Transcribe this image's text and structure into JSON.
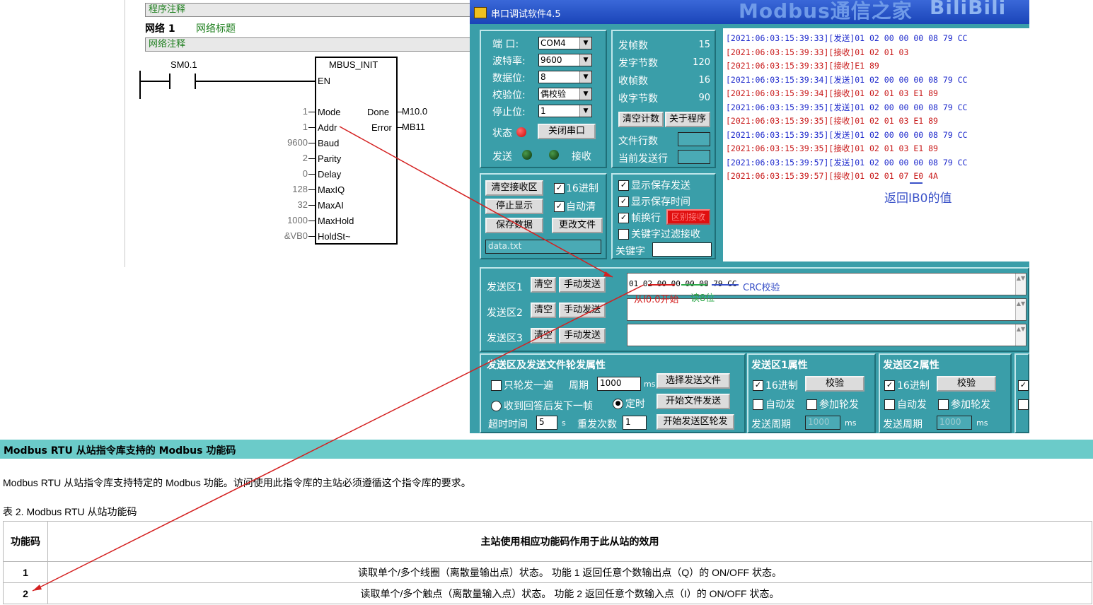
{
  "plc": {
    "program_comment": "程序注释",
    "network_label": "网络 1",
    "network_title": "网络标题",
    "network_comment": "网络注释",
    "contact": "SM0.1",
    "block_name": "MBUS_INIT",
    "en": "EN",
    "inputs": [
      {
        "value": "1",
        "pin": "Mode"
      },
      {
        "value": "1",
        "pin": "Addr"
      },
      {
        "value": "9600",
        "pin": "Baud"
      },
      {
        "value": "2",
        "pin": "Parity"
      },
      {
        "value": "0",
        "pin": "Delay"
      },
      {
        "value": "128",
        "pin": "MaxIQ"
      },
      {
        "value": "32",
        "pin": "MaxAI"
      },
      {
        "value": "1000",
        "pin": "MaxHold"
      },
      {
        "value": "&VB0",
        "pin": "HoldSt~"
      }
    ],
    "outputs": [
      {
        "pin": "Done",
        "value": "M10.0"
      },
      {
        "pin": "Error",
        "value": "MB11"
      }
    ]
  },
  "serial": {
    "title": "串口调试软件4.5",
    "watermark": "Modbus通信之家",
    "watermark2": "BiliBili",
    "port_label": "端  口:",
    "port": "COM4",
    "baud_label": "波特率:",
    "baud": "9600",
    "databits_label": "数据位:",
    "databits": "8",
    "parity_label": "校验位:",
    "parity": "偶校验",
    "stopbits_label": "停止位:",
    "stopbits": "1",
    "status_label": "状态",
    "close_port": "关闭串口",
    "send_label": "发送",
    "recv_label": "接收",
    "counters": [
      {
        "label": "发帧数",
        "value": "15"
      },
      {
        "label": "发字节数",
        "value": "120"
      },
      {
        "label": "收帧数",
        "value": "16"
      },
      {
        "label": "收字节数",
        "value": "90"
      }
    ],
    "clear_count": "清空计数",
    "about": "关于程序",
    "file_lines": "文件行数",
    "cur_line": "当前发送行",
    "clear_recv": "清空接收区",
    "hex16_recv": "16进制",
    "stop_display": "停止显示",
    "auto_clear": "自动清",
    "save_data": "保存数据",
    "change_file": "更改文件",
    "filename": "data.txt",
    "show_save_send": "显示保存发送",
    "show_save_time": "显示保存时间",
    "frame_newline": "帧换行",
    "distinguish": "区别接收",
    "keyword_filter": "关键字过滤接收",
    "keyword": "关键字",
    "recv_lines": [
      {
        "text": "[2021:06:03:15:39:33][发送]01 02 00 00 00 08 79 CC",
        "kind": "tx"
      },
      {
        "text": "[2021:06:03:15:39:33][接收]01 02 01 03",
        "kind": "rx"
      },
      {
        "text": "[2021:06:03:15:39:33][接收]E1 89",
        "kind": "rx"
      },
      {
        "text": "[2021:06:03:15:39:34][发送]01 02 00 00 00 08 79 CC",
        "kind": "tx"
      },
      {
        "text": "[2021:06:03:15:39:34][接收]01 02 01 03 E1 89",
        "kind": "rx"
      },
      {
        "text": "[2021:06:03:15:39:35][发送]01 02 00 00 00 08 79 CC",
        "kind": "tx"
      },
      {
        "text": "[2021:06:03:15:39:35][接收]01 02 01 03 E1 89",
        "kind": "rx"
      },
      {
        "text": "[2021:06:03:15:39:35][发送]01 02 00 00 00 08 79 CC",
        "kind": "tx"
      },
      {
        "text": "[2021:06:03:15:39:35][接收]01 02 01 03 E1 89",
        "kind": "rx"
      },
      {
        "text": "[2021:06:03:15:39:57][发送]01 02 00 00 00 08 79 CC",
        "kind": "tx"
      },
      {
        "text": "[2021:06:03:15:39:57][接收]01 02 01 07 E0 4A",
        "kind": "rx"
      }
    ],
    "send_areas": [
      {
        "label": "发送区1",
        "clear": "清空",
        "manual": "手动发送",
        "value": "01 02 00 00 00 08 79 CC"
      },
      {
        "label": "发送区2",
        "clear": "清空",
        "manual": "手动发送",
        "value": ""
      },
      {
        "label": "发送区3",
        "clear": "清空",
        "manual": "手动发送",
        "value": ""
      }
    ],
    "props_title": "发送区及发送文件轮发属性",
    "only_once": "只轮发一遍",
    "period_label": "周期",
    "period": "1000",
    "ms": "ms",
    "select_file": "选择发送文件",
    "send_next_on_reply": "收到回答后发下一帧",
    "timed": "定时",
    "start_file_send": "开始文件发送",
    "timeout_label": "超时时间",
    "timeout": "5",
    "s": "s",
    "retries_label": "重发次数",
    "retries": "1",
    "start_area_rotate": "开始发送区轮发",
    "area1_props": "发送区1属性",
    "area2_props": "发送区2属性",
    "hex16": "16进制",
    "checksum": "校验",
    "auto_send": "自动发",
    "join_rotate": "参加轮发",
    "send_period": "发送周期",
    "send_period_value": "1000"
  },
  "annotations": {
    "return_ib0": "返回IB0的值",
    "from_i00": "从I0.0开始",
    "read8": "读8位",
    "crc": "CRC校验"
  },
  "doc": {
    "heading": "Modbus RTU 从站指令库支持的 Modbus 功能码",
    "para": "Modbus RTU 从站指令库支持特定的 Modbus 功能。访问使用此指令库的主站必须遵循这个指令库的要求。",
    "caption": "表 2. Modbus RTU 从站功能码",
    "table": {
      "headers": [
        "功能码",
        "主站使用相应功能码作用于此从站的效用"
      ],
      "rows": [
        [
          "1",
          "读取单个/多个线圈（离散量输出点）状态。 功能 1 返回任意个数输出点（Q）的 ON/OFF 状态。"
        ],
        [
          "2",
          "读取单个/多个触点（离散量输入点）状态。 功能 2 返回任意个数输入点（I）的 ON/OFF 状态。"
        ]
      ]
    }
  },
  "colors": {
    "window_bg": "#3a9ea9",
    "titlebar": "#1a44b8",
    "doc_heading": "#6bcbc9",
    "tx_text": "#1e2acc",
    "rx_text": "#c81818",
    "arrow": "#d42020",
    "comment_green": "#208020"
  }
}
